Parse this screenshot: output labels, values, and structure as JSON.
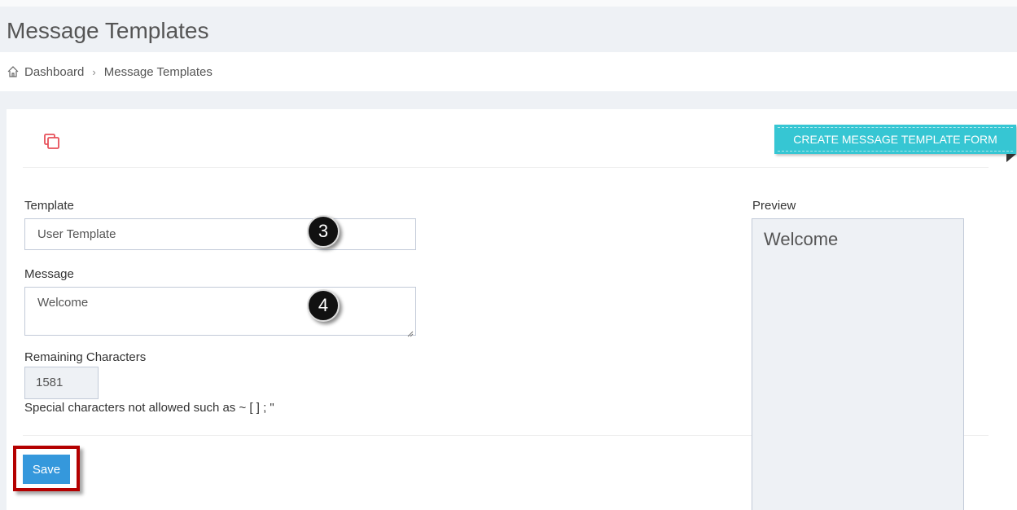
{
  "header": {
    "title": "Message Templates"
  },
  "breadcrumb": {
    "home": "Dashboard",
    "separator": "›",
    "current": "Message Templates"
  },
  "portlet": {
    "ribbon_label": "CREATE MESSAGE TEMPLATE FORM",
    "icon": "copy-icon"
  },
  "form": {
    "template_label": "Template",
    "template_value": "User Template",
    "message_label": "Message",
    "message_value": "Welcome",
    "remaining_label": "Remaining Characters",
    "remaining_value": "1581",
    "note": "Special characters not allowed such as ~ [ ] ; \"",
    "save_label": "Save"
  },
  "preview": {
    "label": "Preview",
    "text": "Welcome"
  },
  "annotations": {
    "badge_template": "3",
    "badge_message": "4"
  },
  "colors": {
    "accent": "#3598dc",
    "ribbon": "#36c6d3",
    "highlight": "#b40000",
    "icon": "#e7505a"
  }
}
